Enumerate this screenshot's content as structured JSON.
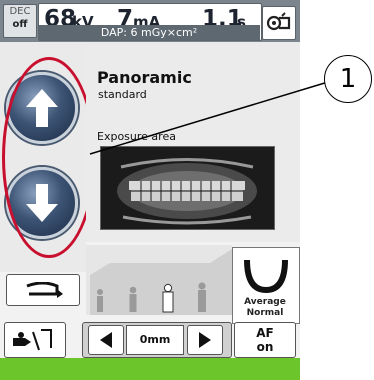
{
  "status": {
    "dec_label": "DEC",
    "dec_state": "off",
    "kv_value": "68",
    "kv_unit": "kV",
    "ma_value": "7",
    "ma_unit": "mA",
    "time_value": "1.1",
    "time_unit": "s",
    "dap_text": "DAP: 6 mGy×cm²"
  },
  "program": {
    "name": "Panoramic",
    "subtype": "standard",
    "exposure_area_label": "Exposure area"
  },
  "callout": {
    "number": "1"
  },
  "jaw": {
    "label_line1": "Average",
    "label_line2": "Normal"
  },
  "bottom": {
    "offset_value": "0mm",
    "af_line1": "AF",
    "af_line2": "on"
  },
  "colors": {
    "highlight_ellipse": "#c8102e",
    "ready_bar": "#6cc52a"
  },
  "icons": [
    "camera-icon",
    "arrow-up-icon",
    "arrow-down-icon",
    "rotate-back-icon",
    "patient-position-icon",
    "patient-size-icons",
    "jaw-shape-icon",
    "left-arrow-icon",
    "right-arrow-icon"
  ]
}
